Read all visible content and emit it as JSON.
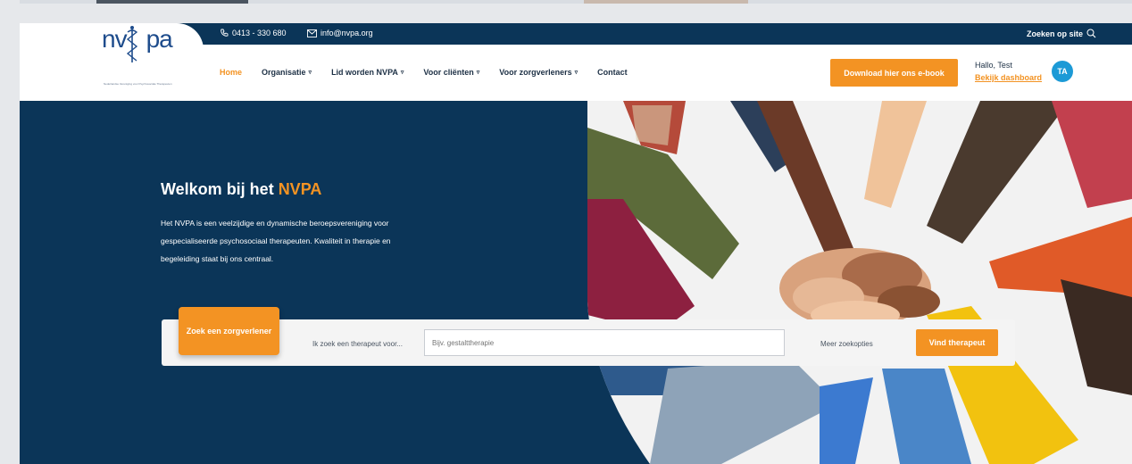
{
  "topbar": {
    "phone": "0413 - 330 680",
    "email": "info@nvpa.org",
    "search": "Zoeken op site"
  },
  "logo": {
    "text_left": "nv",
    "text_right": "pa",
    "subtitle": "Nederlandse Vereniging voor Psychosociale Therapeuten"
  },
  "nav": {
    "items": [
      {
        "label": "Home",
        "active": true,
        "dropdown": false
      },
      {
        "label": "Organisatie",
        "active": false,
        "dropdown": true
      },
      {
        "label": "Lid worden NVPA",
        "active": false,
        "dropdown": true
      },
      {
        "label": "Voor cliënten",
        "active": false,
        "dropdown": true
      },
      {
        "label": "Voor zorgverleners",
        "active": false,
        "dropdown": true
      },
      {
        "label": "Contact",
        "active": false,
        "dropdown": false
      }
    ],
    "ebook": "Download hier ons e-book",
    "hello": "Hallo, Test",
    "dashboard": "Bekijk dashboard",
    "avatar": "TA"
  },
  "hero": {
    "title_main": "Welkom bij het ",
    "title_accent": "NVPA",
    "text": "Het NVPA is een veelzijdige en dynamische beroepsvereniging voor gespecialiseerde psychosociaal therapeuten. Kwaliteit in therapie en begeleiding staat bij ons centraal."
  },
  "search": {
    "tab": "Zoek een zorgverlener",
    "label": "Ik zoek een therapeut voor...",
    "placeholder": "Bijv. gestalttherapie",
    "more": "Meer zoekopties",
    "button": "Vind therapeut"
  },
  "colors": {
    "navy": "#0b3558",
    "orange": "#f39323",
    "avatar": "#1c9ad6"
  }
}
